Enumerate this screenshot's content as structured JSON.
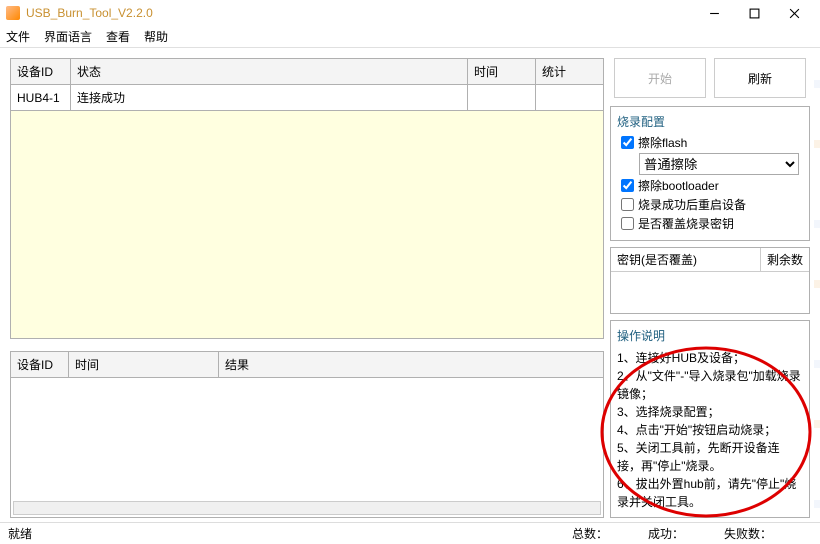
{
  "window": {
    "title": "USB_Burn_Tool_V2.2.0"
  },
  "menu": {
    "file": "文件",
    "lang": "界面语言",
    "view": "查看",
    "help": "帮助"
  },
  "devtable": {
    "headers": {
      "id": "设备ID",
      "status": "状态",
      "time": "时间",
      "stat": "统计"
    },
    "rows": [
      {
        "id": "HUB4-1",
        "status": "连接成功",
        "time": "",
        "stat": ""
      }
    ]
  },
  "logtable": {
    "headers": {
      "id": "设备ID",
      "time": "时间",
      "result": "结果"
    }
  },
  "buttons": {
    "start": "开始",
    "refresh": "刷新"
  },
  "burncfg": {
    "title": "烧录配置",
    "eraseFlash": "擦除flash",
    "eraseMode": "普通擦除",
    "eraseBootloader": "擦除bootloader",
    "rebootAfter": "烧录成功后重启设备",
    "overwriteKey": "是否覆盖烧录密钥"
  },
  "keypanel": {
    "col1": "密钥(是否覆盖)",
    "col2": "剩余数"
  },
  "instructions": {
    "title": "操作说明",
    "lines": [
      "1、连接好HUB及设备；",
      "2、从\"文件\"-\"导入烧录包\"加载烧录镜像；",
      "3、选择烧录配置；",
      "4、点击\"开始\"按钮启动烧录；",
      "5、关闭工具前，先断开设备连接，再\"停止\"烧录。",
      "6、拔出外置hub前，请先\"停止\"烧录并关闭工具。"
    ]
  },
  "status": {
    "ready": "就绪",
    "total": "总数：",
    "success": "成功：",
    "fail": "失败数："
  }
}
